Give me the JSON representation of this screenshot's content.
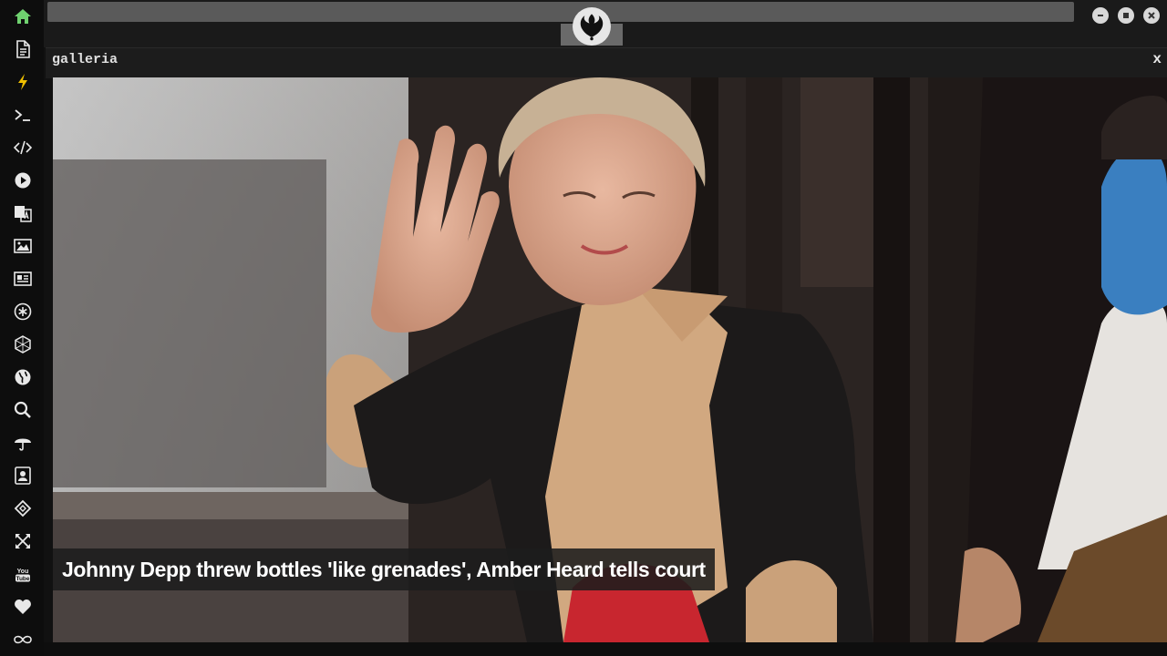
{
  "panel": {
    "title": "galleria",
    "close_label": "x"
  },
  "gallery": {
    "caption": "Johnny Depp threw bottles 'like grenades', Amber Heard tells court"
  },
  "sidebar": {
    "items": [
      {
        "icon": "home-icon",
        "color": "#6fd16f"
      },
      {
        "icon": "document-icon"
      },
      {
        "icon": "lightning-icon",
        "color": "#f0c000"
      },
      {
        "icon": "terminal-icon"
      },
      {
        "icon": "code-icon"
      },
      {
        "icon": "play-icon"
      },
      {
        "icon": "translate-icon"
      },
      {
        "icon": "image-icon"
      },
      {
        "icon": "newspaper-icon"
      },
      {
        "icon": "asterisk-icon"
      },
      {
        "icon": "hexagon-icon"
      },
      {
        "icon": "globe-icon"
      },
      {
        "icon": "search-icon"
      },
      {
        "icon": "umbrella-icon"
      },
      {
        "icon": "contact-icon"
      },
      {
        "icon": "diamond-icon"
      },
      {
        "icon": "expand-icon"
      },
      {
        "icon": "youtube-icon"
      },
      {
        "icon": "heart-icon"
      },
      {
        "icon": "infinity-icon"
      }
    ]
  },
  "window": {
    "controls": [
      "minimize",
      "maximize",
      "close"
    ]
  }
}
